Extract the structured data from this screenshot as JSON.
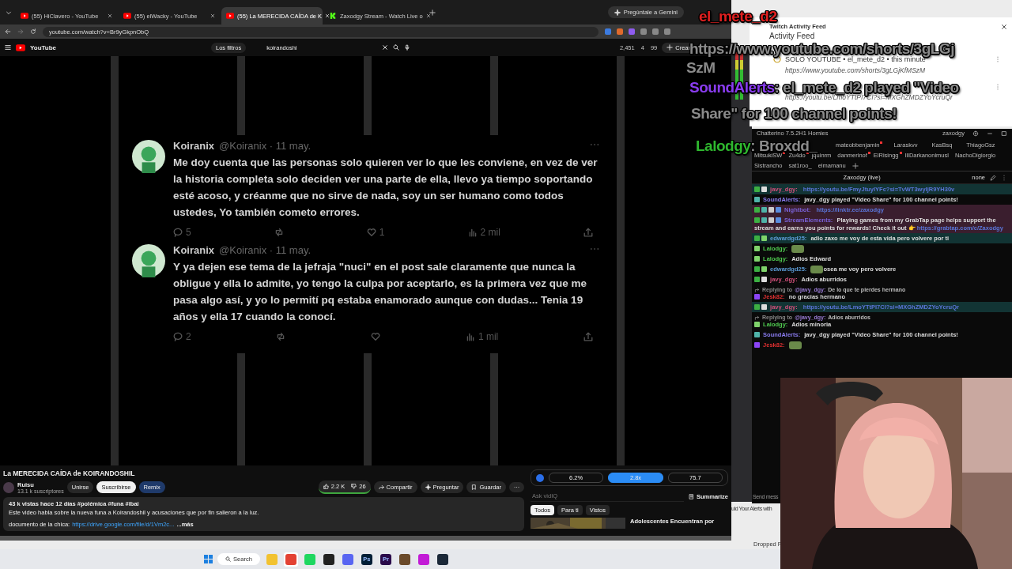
{
  "browser": {
    "tabs": [
      {
        "label": "(55) HiClavero - YouTube",
        "kind": "youtube",
        "selected": false
      },
      {
        "label": "(55) elWacky - YouTube",
        "kind": "youtube",
        "selected": false
      },
      {
        "label": "(55) La MERECIDA CAÍDA de K",
        "kind": "youtube",
        "selected": true
      },
      {
        "label": "Zaxodgy Stream - Watch Live o",
        "kind": "kick",
        "selected": false
      }
    ],
    "gemini_button": "Pregúntale a Gemini",
    "url": "youtube.com/watch?v=Br9yGkpnObQ"
  },
  "youtube": {
    "logo": "YouTube",
    "filter_chip": "Los filtros",
    "search": {
      "value": "koirandoshi"
    },
    "stats": [
      "2,451",
      "4",
      "99"
    ],
    "create_button": "Crear",
    "tweets": [
      {
        "name": "Koiranix",
        "handle": "@Koiranix",
        "date": "· 11 may.",
        "text": "Me doy cuenta que las personas solo quieren ver lo que les conviene, en vez de ver la historia completa solo deciden ver una parte de ella, llevo ya tiempo soportando esté acoso, y créanme que no sirve de nada, soy un ser humano como todos ustedes, Yo también cometo errores.",
        "replies": "5",
        "likes": "1",
        "views": "2 mil"
      },
      {
        "name": "Koiranix",
        "handle": "@Koiranix",
        "date": "· 11 may.",
        "text": "Y ya dejen ese tema de la jefraja \"nuci\" en el post sale claramente que nunca la obligue y ella lo admite, yo tengo la culpa por aceptarlo, es la primera vez que me pasa algo así, y yo lo permití pq estaba enamorado aunque con dudas... Tenia 19 años y ella 17 cuando la conocí.",
        "replies": "2",
        "views": "1 mil"
      }
    ],
    "title": "La MERECIDA CAÍDA de KOIRANDOSHIL",
    "channel": {
      "name": "Ruisu",
      "subscribers": "13.1 k suscriptores"
    },
    "join_button": "Unirse",
    "subscribe_button": "Suscribirse",
    "remix_button": "Remix",
    "likes": "2.2 K",
    "dislikes": "26",
    "share_button": "Compartir",
    "ask_button": "Preguntar",
    "save_button": "Guardar",
    "description": {
      "meta": "43 k vistas  hace 12 días  #polémica #funa #ibai",
      "text": "Este video habla sobre la nueva funa a Koirandoshil y acusaciones que por fin salieron a la luz.",
      "doc_label": "documento de la chica:",
      "doc_link": "https://drive.google.com/file/d/1Vm2c...",
      "more": "...más"
    },
    "vidiq": {
      "metrics": [
        {
          "text": "6.2%",
          "selected": false
        },
        {
          "text": "2.8x",
          "selected": true
        },
        {
          "text": "75.7",
          "selected": false
        }
      ],
      "ask": {
        "placeholder": "Ask vidIQ"
      },
      "summarize_button": "Summarize"
    },
    "chips": [
      {
        "label": "Todos",
        "selected": true
      },
      {
        "label": "Para ti",
        "selected": false
      },
      {
        "label": "Vistos",
        "selected": false
      }
    ],
    "recommended_title": "Adolescentes Encuentran por"
  },
  "activity_feed": {
    "window_title": "Twitch Activity Feed",
    "heading": "Activity Feed",
    "items": [
      {
        "title": "SOLO YOUTUBE • el_mete_d2 • this minute",
        "url": "https://www.youtube.com/shorts/3gLGjKfMSzM"
      },
      {
        "url": "https://youtu.be/LmoYTtPI7CI?si=MXGhZMDZYoYcruQr"
      }
    ]
  },
  "chatterino": {
    "title": "Chatterino 7.5.2H1 Homies",
    "account": "zaxodgy",
    "tab_rows": [
      [
        {
          "label": "mateobbenjamin",
          "unread": true
        },
        {
          "label": "Laraskvv",
          "unread": false
        },
        {
          "label": "KasBsq",
          "unread": false
        },
        {
          "label": "ThiagoGsz",
          "unread": false
        }
      ],
      [
        {
          "label": "MitsukiSW",
          "unread": true
        },
        {
          "label": "Zu4do",
          "unread": true
        },
        {
          "label": "jquinrm",
          "unread": false
        },
        {
          "label": "danmerinof",
          "unread": true
        },
        {
          "label": "ElRisingg",
          "unread": true
        },
        {
          "label": "lIlDarkanonimusl",
          "unread": false
        },
        {
          "label": "NachoDigiorgio",
          "unread": false
        }
      ],
      [
        {
          "label": "Sistrancho",
          "unread": false
        },
        {
          "label": "sat1roo_",
          "unread": false
        },
        {
          "label": "elmamanu",
          "unread": false
        }
      ]
    ],
    "split_title": "Zaxodgy (live)",
    "split_mode": "none",
    "messages": [
      {
        "color": "#123434",
        "badges": [
          {
            "kind": "check"
          },
          {
            "kind": "skull"
          }
        ],
        "user": {
          "name": "javy_dgy:",
          "color": "#d0507a"
        },
        "segments": [
          {
            "kind": "link",
            "text": "https://youtu.be/FmyJtuyIYFc?si=TvWT3wyIjR9YH30v"
          }
        ]
      },
      {
        "badges": [
          {
            "kind": "bot"
          }
        ],
        "user": {
          "name": "SoundAlerts:",
          "color": "#8a7cf0"
        },
        "segments": [
          {
            "kind": "text",
            "text": "javy_dgy played \"Video Share\" for 100 channel points!"
          }
        ]
      },
      {
        "color": "#3a1e2e",
        "badges": [
          {
            "kind": "check"
          },
          {
            "kind": "bot"
          },
          {
            "kind": "gear"
          },
          {
            "kind": "cloud"
          }
        ],
        "user": {
          "name": "Nightbot:",
          "color": "#7a62d8"
        },
        "segments": [
          {
            "kind": "link",
            "text": "https://linktr.ee/zaxodgy"
          }
        ]
      },
      {
        "color": "#3a1e2e",
        "badges": [
          {
            "kind": "check"
          },
          {
            "kind": "bot"
          },
          {
            "kind": "gear"
          },
          {
            "kind": "cloud"
          }
        ],
        "user": {
          "name": "StreamElements:",
          "color": "#7a62d8"
        },
        "segments": [
          {
            "kind": "text",
            "text": "Playing games from my GrabTap page helps support the stream and earns you points for rewards! Check it out 👉"
          },
          {
            "kind": "link",
            "text": "https://grabtap.com/c/Zaxodgy"
          }
        ]
      },
      {
        "color": "#123434",
        "badges": [
          {
            "kind": "check"
          },
          {
            "kind": "sprout"
          }
        ],
        "user": {
          "name": "edwardgd25:",
          "color": "#5b9bd5"
        },
        "segments": [
          {
            "kind": "text",
            "text": "adio zaxo me voy de esta vida pero volvere por ti"
          }
        ]
      },
      {
        "badges": [
          {
            "kind": "sprout"
          }
        ],
        "user": {
          "name": "Lalodgy:",
          "color": "#4fc94f"
        },
        "segments": [
          {
            "kind": "emote"
          }
        ]
      },
      {
        "badges": [
          {
            "kind": "sprout"
          }
        ],
        "user": {
          "name": "Lalodgy:",
          "color": "#4fc94f"
        },
        "segments": [
          {
            "kind": "text",
            "text": "Adios Edward"
          }
        ]
      },
      {
        "badges": [
          {
            "kind": "check"
          },
          {
            "kind": "sprout"
          }
        ],
        "user": {
          "name": "edwardgd25:",
          "color": "#5b9bd5"
        },
        "segments": [
          {
            "kind": "emote"
          },
          {
            "kind": "text",
            "text": "osea me voy pero volvere"
          }
        ]
      },
      {
        "badges": [
          {
            "kind": "check"
          },
          {
            "kind": "skull"
          }
        ],
        "user": {
          "name": "javy_dgy:",
          "color": "#d0507a"
        },
        "segments": [
          {
            "kind": "text",
            "text": "Adios aburridos"
          }
        ]
      },
      {
        "reply": {
          "label": "Replying to",
          "to": "@javy_dgy:",
          "text": "De lo que te pierdes hermano"
        },
        "badges": [
          {
            "kind": "prime"
          }
        ],
        "user": {
          "name": "Jesk82:",
          "color": "#e03030"
        },
        "segments": [
          {
            "kind": "text",
            "text": "no gracias hermano"
          }
        ]
      },
      {
        "color": "#123434",
        "badges": [
          {
            "kind": "check"
          },
          {
            "kind": "skull"
          }
        ],
        "user": {
          "name": "javy_dgy:",
          "color": "#d0507a"
        },
        "segments": [
          {
            "kind": "link",
            "text": "https://youtu.be/LmoYTtPI7CI?si=MXGhZMDZYoYcruQr"
          }
        ]
      },
      {
        "reply": {
          "label": "Replying to",
          "to": "@javy_dgy:",
          "text": "Adios aburridos"
        },
        "badges": [
          {
            "kind": "sprout"
          }
        ],
        "user": {
          "name": "Lalodgy:",
          "color": "#4fc94f"
        },
        "segments": [
          {
            "kind": "text",
            "text": "Adios minoria"
          }
        ]
      },
      {
        "badges": [
          {
            "kind": "bot"
          }
        ],
        "user": {
          "name": "SoundAlerts:",
          "color": "#8a7cf0"
        },
        "segments": [
          {
            "kind": "text",
            "text": "javy_dgy played \"Video Share\" for 100 channel points!"
          }
        ]
      },
      {
        "badges": [
          {
            "kind": "prime"
          }
        ],
        "user": {
          "name": "Jesk82:",
          "color": "#e03030"
        },
        "segments": [
          {
            "kind": "emote"
          }
        ]
      }
    ],
    "input_placeholder": "Send mess"
  },
  "side_texts": [
    "uld Your Alerts with",
    "Dropped F"
  ],
  "overlay": [
    {
      "user": {
        "name": "el_mete_d2",
        "color": "#e02020"
      }
    },
    {
      "text": "https://www.youtube.com/shorts/3gLGj"
    },
    {
      "text": "SzM"
    },
    {
      "user": {
        "name": "SoundAlerts",
        "color": "#8a3cf0"
      },
      "text": ": el_mete_d2 played \"Video"
    },
    {
      "text": "Share\" for 100 channel points!"
    },
    {
      "user": {
        "name": "Lalodgy",
        "color": "#2fb82f"
      },
      "text": ": Broxdd_"
    }
  ],
  "taskbar": {
    "search": "Search",
    "apps": [
      {
        "kind": "folder",
        "selected": false
      },
      {
        "kind": "chrome",
        "selected": true
      },
      {
        "kind": "spotify",
        "selected": false
      },
      {
        "kind": "dark",
        "selected": false
      },
      {
        "kind": "discord",
        "selected": false
      },
      {
        "kind": "ps",
        "selected": false,
        "label": "Ps"
      },
      {
        "kind": "pr",
        "selected": false,
        "label": "Pr"
      },
      {
        "kind": "fl",
        "selected": false
      },
      {
        "kind": "c",
        "selected": false
      },
      {
        "kind": "steam",
        "selected": false
      }
    ]
  }
}
